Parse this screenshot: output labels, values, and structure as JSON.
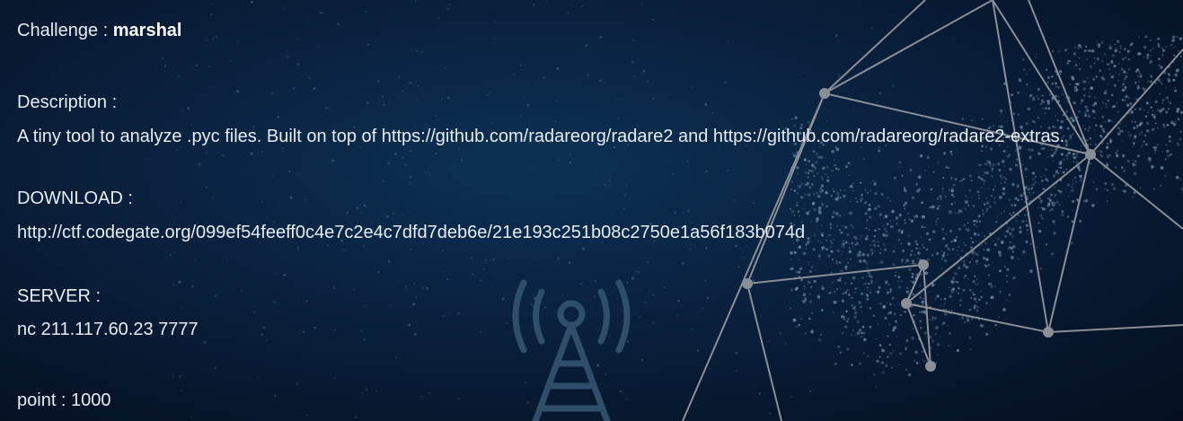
{
  "challenge": {
    "label": "Challenge : ",
    "name": "marshal"
  },
  "description": {
    "label": "Description :",
    "text": "A tiny tool to analyze .pyc files. Built on top of https://github.com/radareorg/radare2 and https://github.com/radareorg/radare2-extras."
  },
  "download": {
    "label": "DOWNLOAD :",
    "url": "http://ctf.codegate.org/099ef54feeff0c4e7c2e4c7dfd7deb6e/21e193c251b08c2750e1a56f183b074d"
  },
  "server": {
    "label": "SERVER :",
    "address": "nc 211.117.60.23 7777"
  },
  "point": {
    "text": "point : 1000"
  },
  "colors": {
    "text": "#e6ecf2",
    "background": "#0a2240",
    "network_lines": "#8a8f95",
    "particles": "#6f8fa3"
  }
}
